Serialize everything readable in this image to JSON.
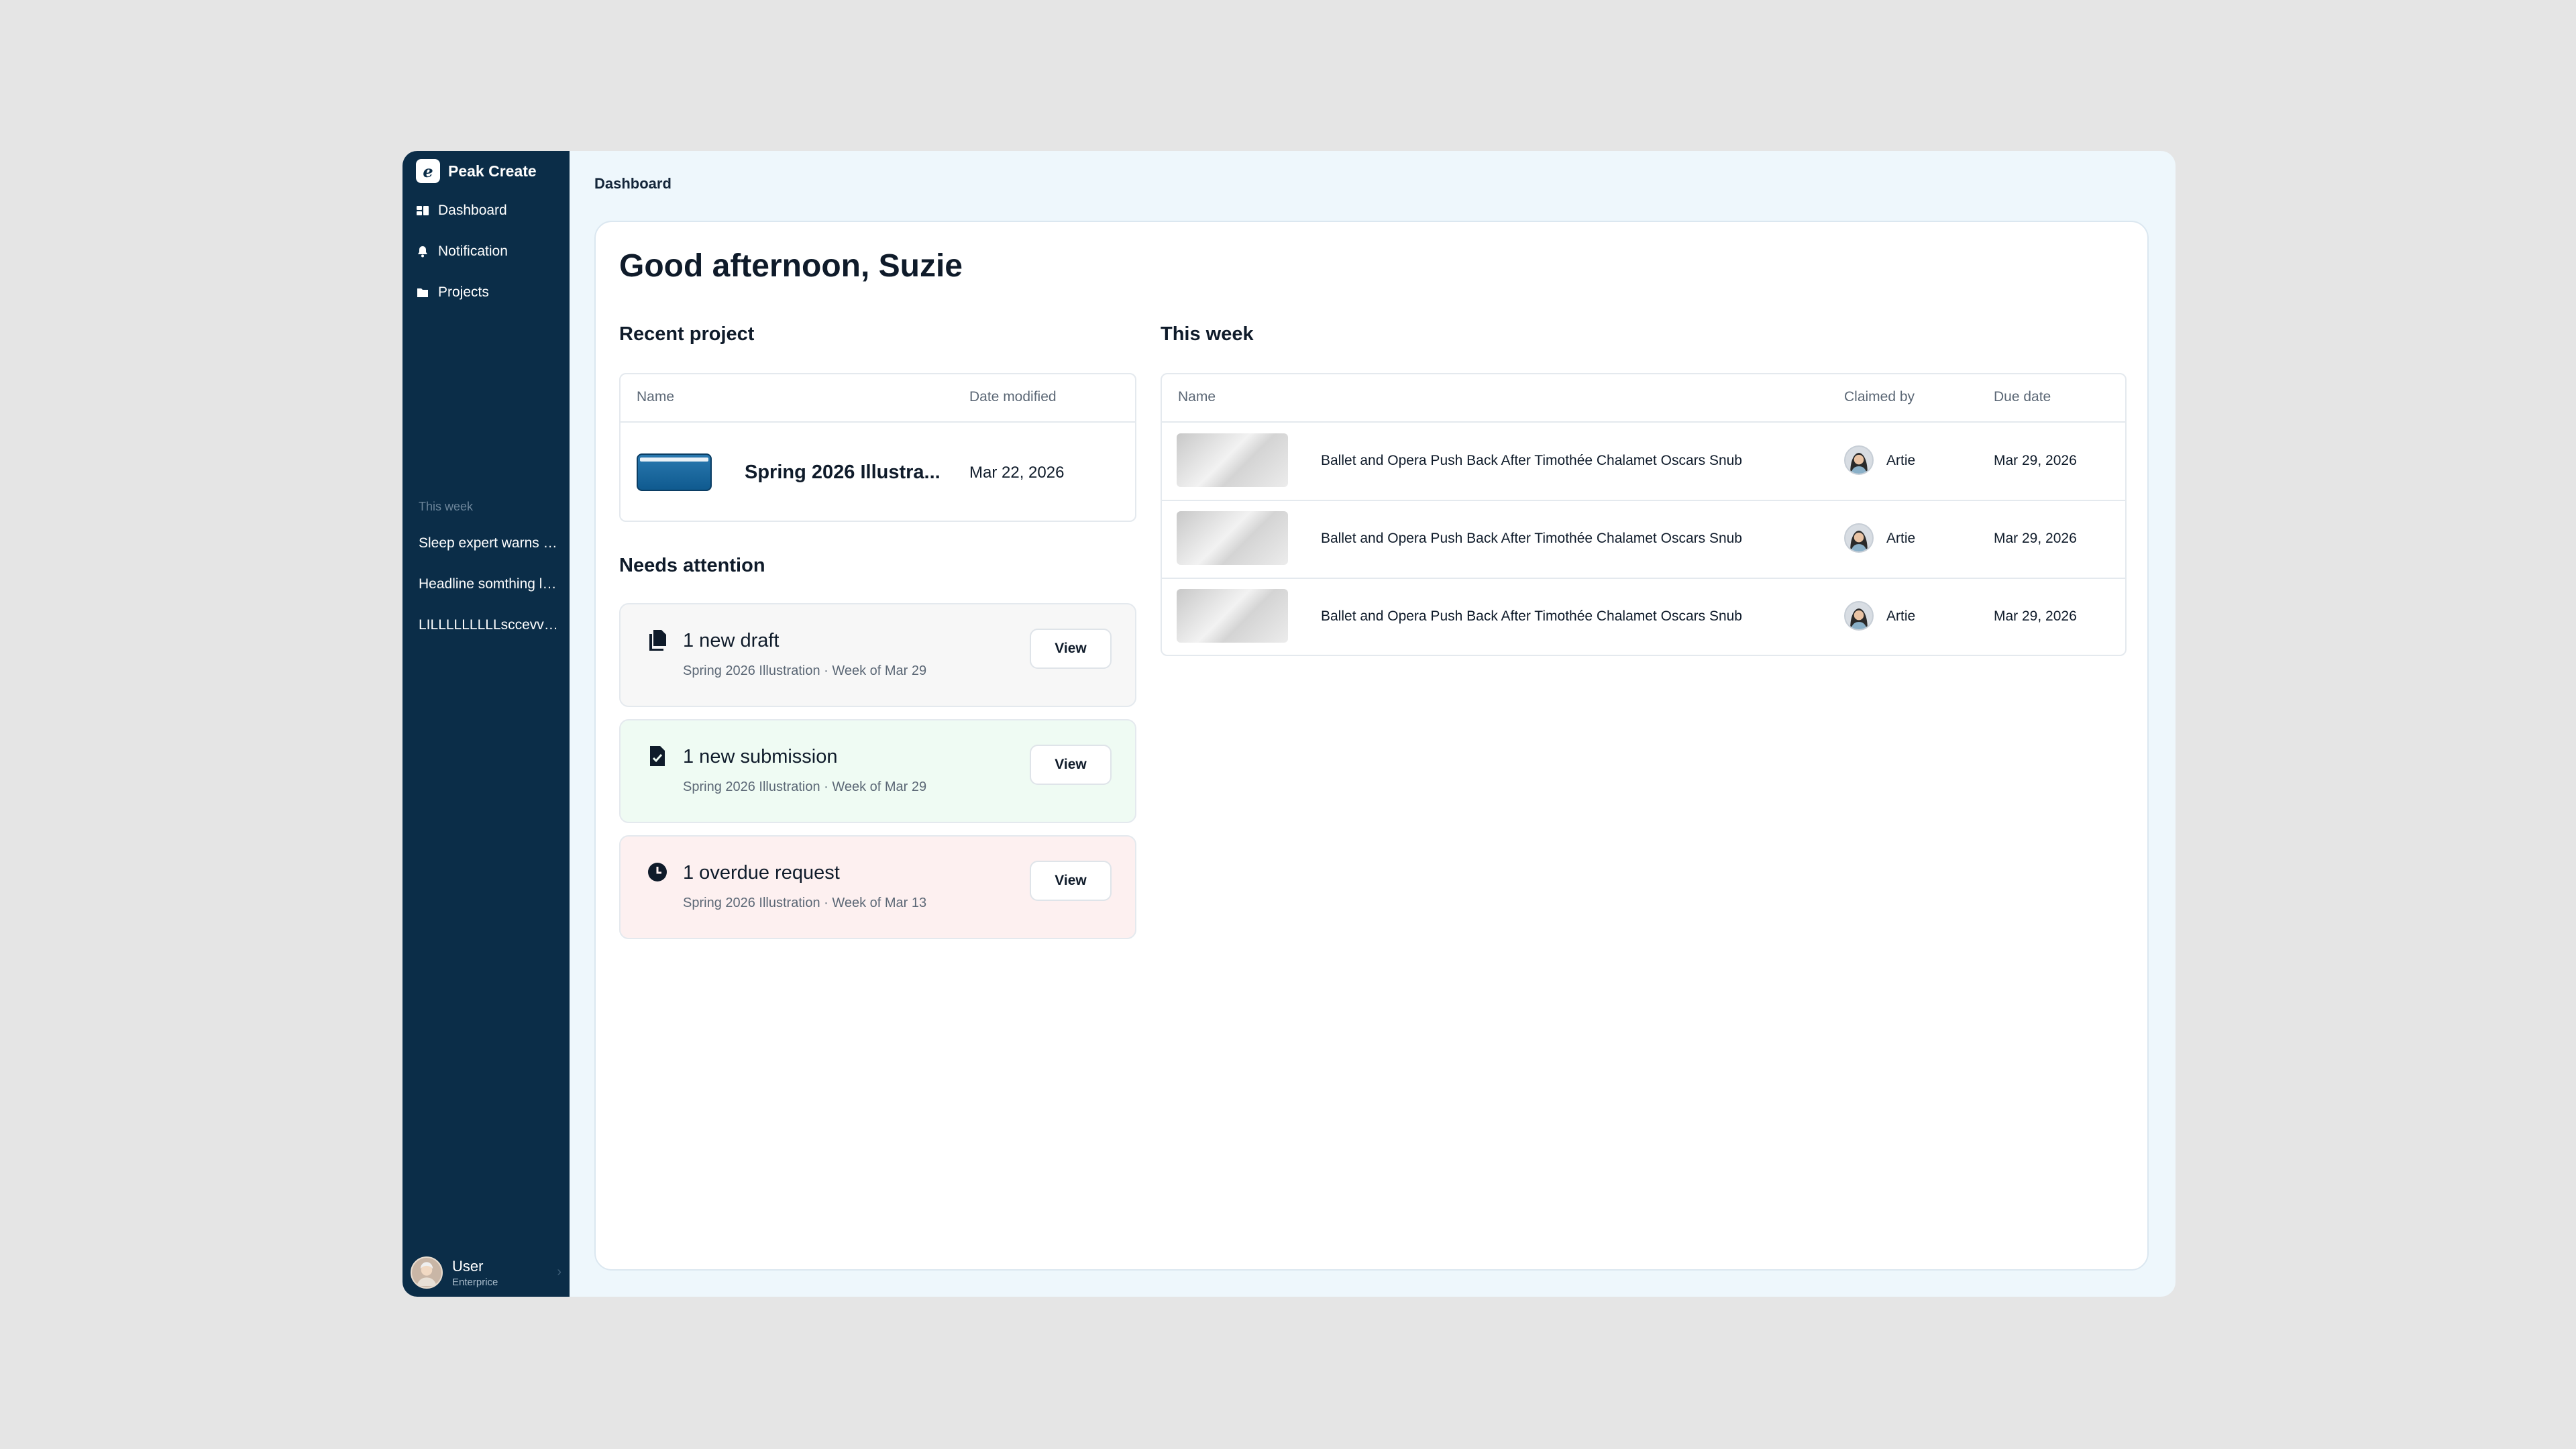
{
  "app": {
    "name": "Peak Create",
    "logo_letter": "e"
  },
  "sidebar": {
    "nav": [
      {
        "label": "Dashboard",
        "icon": "dashboard-icon"
      },
      {
        "label": "Notification",
        "icon": "bell-icon"
      },
      {
        "label": "Projects",
        "icon": "folder-icon"
      }
    ],
    "section_label": "This week",
    "recent": [
      "Sleep expert warns about screens before bed",
      "Headline somthing long enough to truncate",
      "LILLLLLLLLLsccevvvvv"
    ],
    "user": {
      "name": "User",
      "plan": "Enterprice",
      "chevron": "›"
    }
  },
  "breadcrumb": "Dashboard",
  "greeting": "Good afternoon, Suzie",
  "recent_project": {
    "title": "Recent project",
    "headers": {
      "name": "Name",
      "date": "Date modified"
    },
    "row": {
      "name": "Spring 2026 Illustra...",
      "date": "Mar 22, 2026"
    }
  },
  "needs_attention": {
    "title": "Needs attention",
    "items": [
      {
        "icon": "copy-document-icon",
        "title": "1 new draft",
        "subtitle": "Spring 2026 Illustration · Week of Mar 29",
        "button": "View",
        "bg": "#f7f7f7"
      },
      {
        "icon": "document-check-icon",
        "title": "1 new submission",
        "subtitle": "Spring 2026 Illustration · Week of Mar 29",
        "button": "View",
        "bg": "#effbf3"
      },
      {
        "icon": "clock-icon",
        "title": "1 overdue request",
        "subtitle": "Spring 2026 Illustration · Week of Mar 13",
        "button": "View",
        "bg": "#fdf0f0"
      }
    ]
  },
  "this_week": {
    "title": "This week",
    "headers": {
      "name": "Name",
      "claimed": "Claimed by",
      "due": "Due date"
    },
    "rows": [
      {
        "name": "Ballet and Opera Push Back After Timothée Chalamet Oscars Snub",
        "claimed_by": "Artie",
        "due": "Mar 29, 2026"
      },
      {
        "name": "Ballet and Opera Push Back After Timothée Chalamet Oscars Snub",
        "claimed_by": "Artie",
        "due": "Mar 29, 2026"
      },
      {
        "name": "Ballet and Opera Push Back After Timothée Chalamet Oscars Snub",
        "claimed_by": "Artie",
        "due": "Mar 29, 2026"
      }
    ]
  },
  "colors": {
    "sidebar": "#0b2d48",
    "background": "#eef7fc",
    "page": "#e5e5e5"
  }
}
